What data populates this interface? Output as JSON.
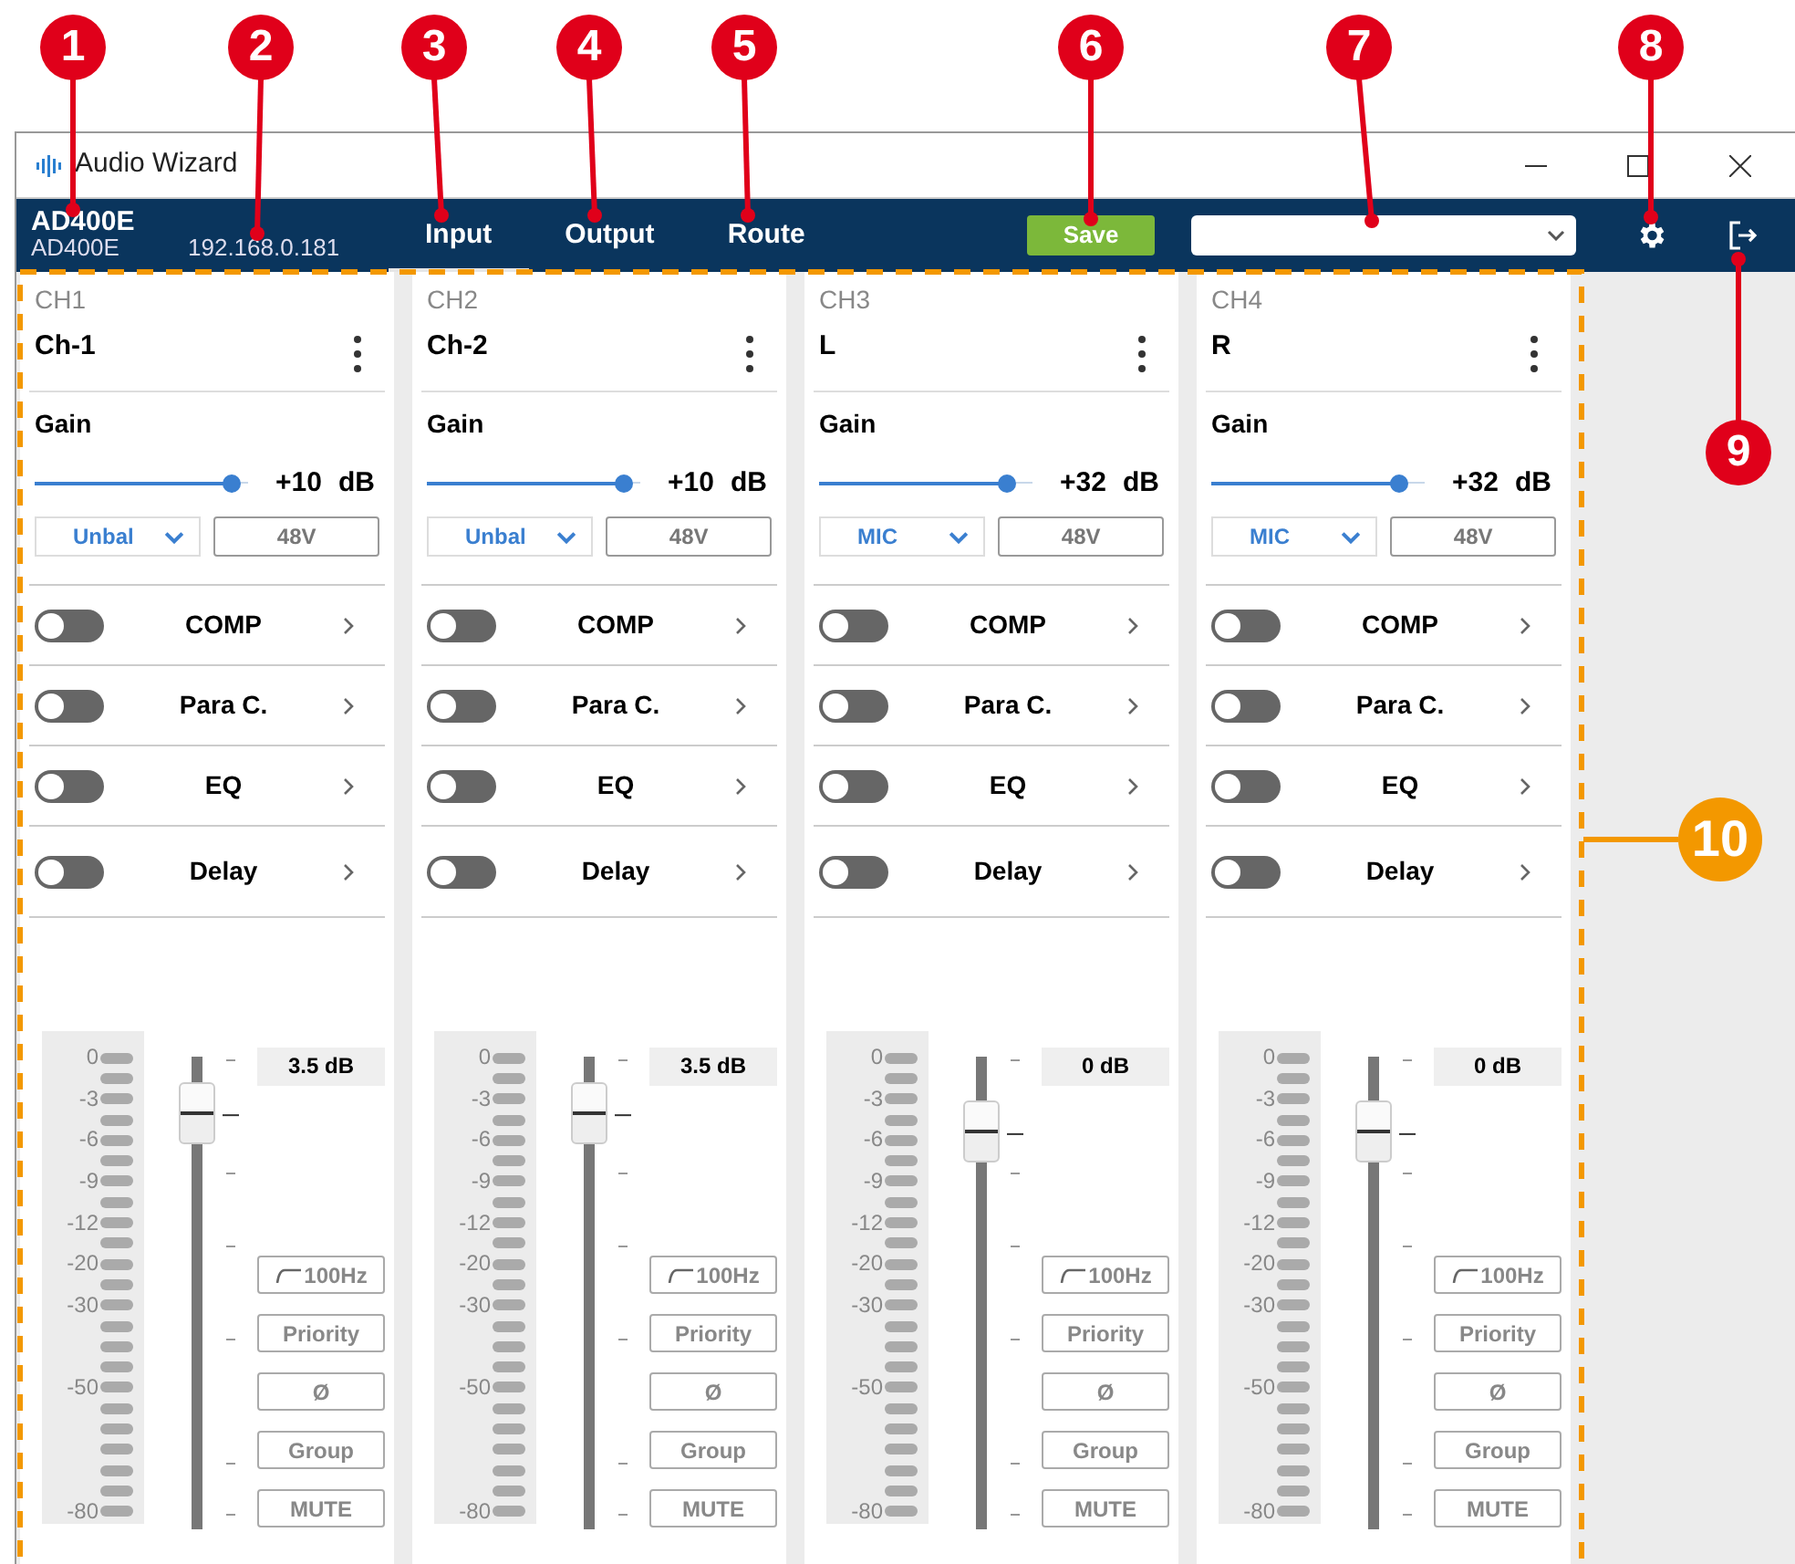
{
  "callouts": [
    {
      "number": "1",
      "color": "#e0001a"
    },
    {
      "number": "2",
      "color": "#e0001a"
    },
    {
      "number": "3",
      "color": "#e0001a"
    },
    {
      "number": "4",
      "color": "#e0001a"
    },
    {
      "number": "5",
      "color": "#e0001a"
    },
    {
      "number": "6",
      "color": "#e0001a"
    },
    {
      "number": "7",
      "color": "#e0001a"
    },
    {
      "number": "8",
      "color": "#e0001a"
    },
    {
      "number": "9",
      "color": "#e0001a"
    },
    {
      "number": "10",
      "color": "#f39800"
    }
  ],
  "window": {
    "title": "Audio Wizard"
  },
  "device": {
    "name": "AD400E",
    "model": "AD400E",
    "ip": "192.168.0.181"
  },
  "tabs": [
    {
      "label": "Input",
      "selected": true
    },
    {
      "label": "Output",
      "selected": false
    },
    {
      "label": "Route",
      "selected": false
    }
  ],
  "save_button": "Save",
  "channels": [
    {
      "id": "CH1",
      "name": "Ch-1",
      "gain_label": "Gain",
      "gain_slider": {
        "level": 0.92
      },
      "gain": "+10",
      "gain_unit": "dB",
      "input_type": "Unbal",
      "phantom": "48V",
      "processors": [
        {
          "label": "COMP",
          "on": false
        },
        {
          "label": "Para C.",
          "on": false
        },
        {
          "label": "EQ",
          "on": false
        },
        {
          "label": "Delay",
          "on": false
        }
      ],
      "meter_scale": [
        "0",
        "-3",
        "-6",
        "-9",
        "-12",
        "-20",
        "-30",
        "-50",
        "-80"
      ],
      "fader": {
        "level": 0.88
      },
      "fader_reading": "3.5 dB",
      "buttons": [
        {
          "kind": "filter",
          "label": "100Hz"
        },
        {
          "kind": "plain",
          "label": "Priority"
        },
        {
          "kind": "plain",
          "label": "Ø"
        },
        {
          "kind": "plain",
          "label": "Group"
        },
        {
          "kind": "plain",
          "label": "MUTE"
        }
      ]
    },
    {
      "id": "CH2",
      "name": "Ch-2",
      "gain_label": "Gain",
      "gain_slider": {
        "level": 0.92
      },
      "gain": "+10",
      "gain_unit": "dB",
      "input_type": "Unbal",
      "phantom": "48V",
      "processors": [
        {
          "label": "COMP",
          "on": false
        },
        {
          "label": "Para C.",
          "on": false
        },
        {
          "label": "EQ",
          "on": false
        },
        {
          "label": "Delay",
          "on": false
        }
      ],
      "meter_scale": [
        "0",
        "-3",
        "-6",
        "-9",
        "-12",
        "-20",
        "-30",
        "-50",
        "-80"
      ],
      "fader": {
        "level": 0.88
      },
      "fader_reading": "3.5 dB",
      "buttons": [
        {
          "kind": "filter",
          "label": "100Hz"
        },
        {
          "kind": "plain",
          "label": "Priority"
        },
        {
          "kind": "plain",
          "label": "Ø"
        },
        {
          "kind": "plain",
          "label": "Group"
        },
        {
          "kind": "plain",
          "label": "MUTE"
        }
      ]
    },
    {
      "id": "CH3",
      "name": "L",
      "gain_label": "Gain",
      "gain_slider": {
        "level": 0.88
      },
      "gain": "+32",
      "gain_unit": "dB",
      "input_type": "MIC",
      "phantom": "48V",
      "processors": [
        {
          "label": "COMP",
          "on": false
        },
        {
          "label": "Para C.",
          "on": false
        },
        {
          "label": "EQ",
          "on": false
        },
        {
          "label": "Delay",
          "on": false
        }
      ],
      "meter_scale": [
        "0",
        "-3",
        "-6",
        "-9",
        "-12",
        "-20",
        "-30",
        "-50",
        "-80"
      ],
      "fader": {
        "level": 0.84
      },
      "fader_reading": "0 dB",
      "buttons": [
        {
          "kind": "filter",
          "label": "100Hz"
        },
        {
          "kind": "plain",
          "label": "Priority"
        },
        {
          "kind": "plain",
          "label": "Ø"
        },
        {
          "kind": "plain",
          "label": "Group"
        },
        {
          "kind": "plain",
          "label": "MUTE"
        }
      ]
    },
    {
      "id": "CH4",
      "name": "R",
      "gain_label": "Gain",
      "gain_slider": {
        "level": 0.88
      },
      "gain": "+32",
      "gain_unit": "dB",
      "input_type": "MIC",
      "phantom": "48V",
      "processors": [
        {
          "label": "COMP",
          "on": false
        },
        {
          "label": "Para C.",
          "on": false
        },
        {
          "label": "EQ",
          "on": false
        },
        {
          "label": "Delay",
          "on": false
        }
      ],
      "meter_scale": [
        "0",
        "-3",
        "-6",
        "-9",
        "-12",
        "-20",
        "-30",
        "-50",
        "-80"
      ],
      "fader": {
        "level": 0.84
      },
      "fader_reading": "0 dB",
      "buttons": [
        {
          "kind": "filter",
          "label": "100Hz"
        },
        {
          "kind": "plain",
          "label": "Priority"
        },
        {
          "kind": "plain",
          "label": "Ø"
        },
        {
          "kind": "plain",
          "label": "Group"
        },
        {
          "kind": "plain",
          "label": "MUTE"
        }
      ]
    }
  ]
}
